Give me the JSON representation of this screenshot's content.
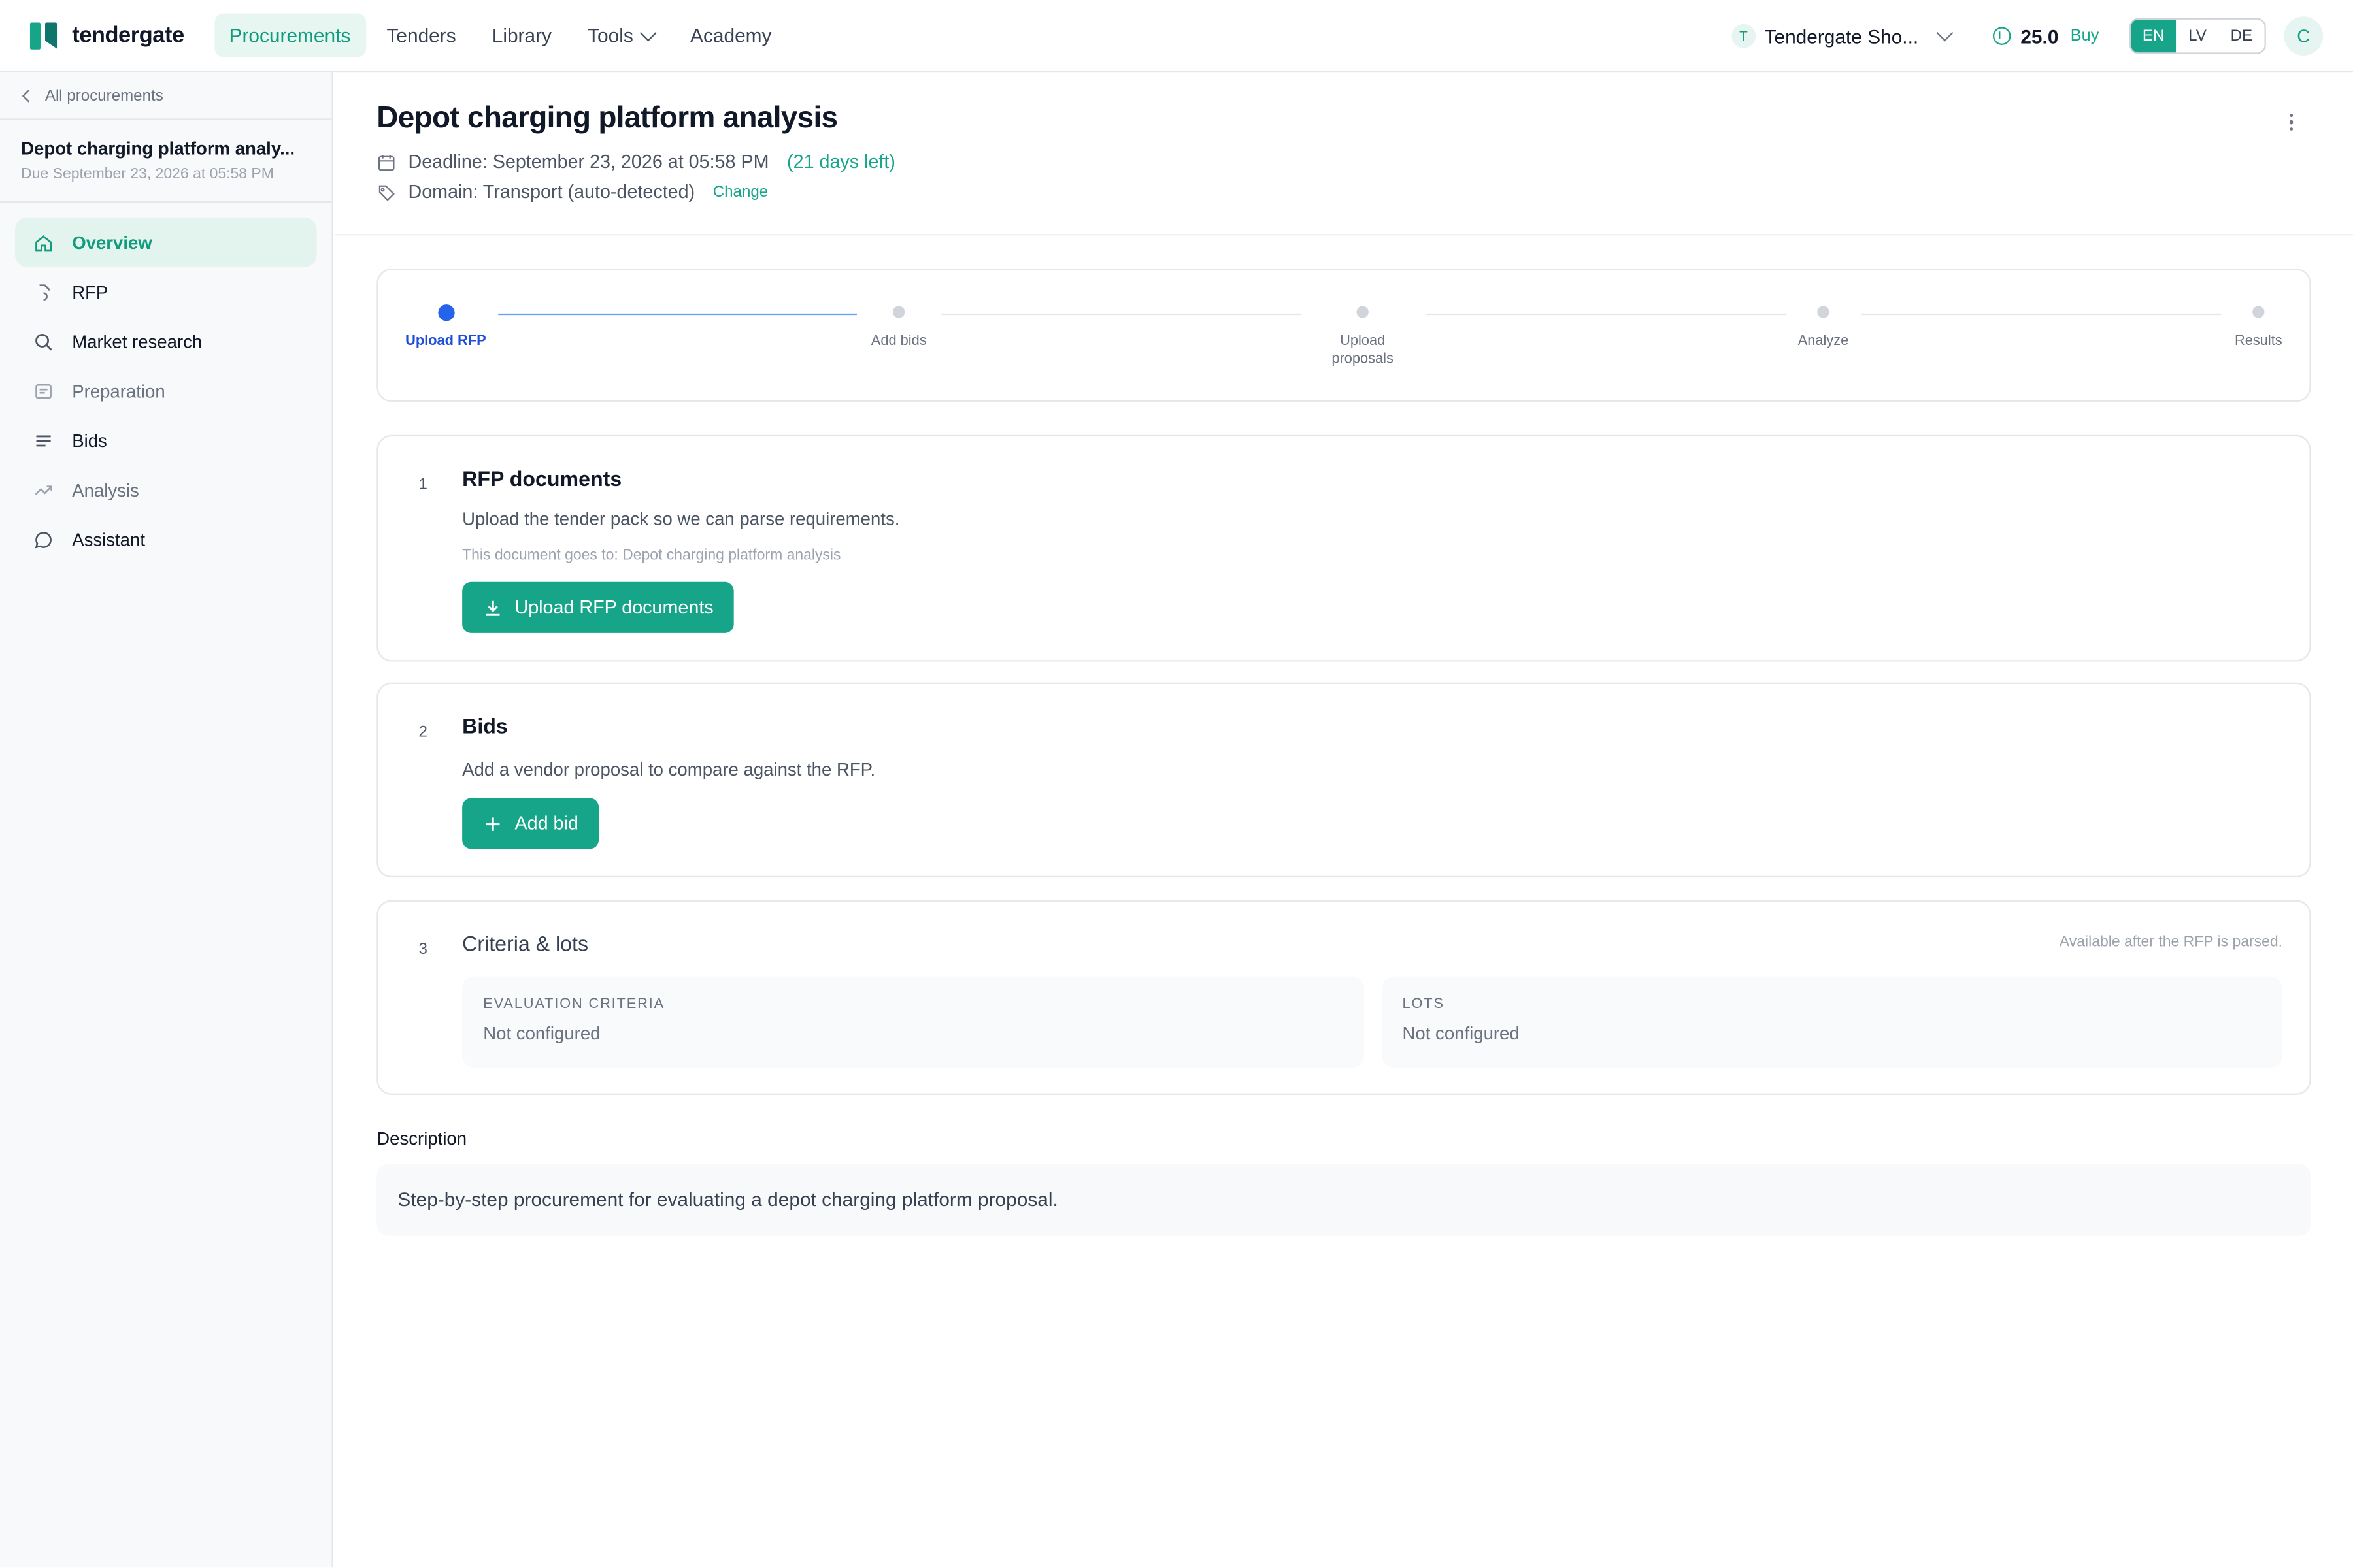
{
  "app": {
    "brand": "tendergate",
    "nav": [
      "Procurements",
      "Tenders",
      "Library",
      "Tools",
      "Academy"
    ],
    "org_initial": "T",
    "org_name": "Tendergate Sho...",
    "credits": "25.0",
    "buy_label": "Buy",
    "languages": [
      "EN",
      "LV",
      "DE"
    ],
    "user_initial": "C"
  },
  "sidebar": {
    "back_label": "All procurements",
    "title": "Depot charging platform analy...",
    "due": "Due September 23, 2026 at 05:58 PM",
    "items": [
      {
        "label": "Overview",
        "icon": "home-icon"
      },
      {
        "label": "RFP",
        "icon": "document-icon"
      },
      {
        "label": "Market research",
        "icon": "search-icon"
      },
      {
        "label": "Preparation",
        "icon": "clipboard-icon"
      },
      {
        "label": "Bids",
        "icon": "list-icon"
      },
      {
        "label": "Analysis",
        "icon": "trend-icon"
      },
      {
        "label": "Assistant",
        "icon": "chat-icon"
      }
    ]
  },
  "page": {
    "title": "Depot charging platform analysis",
    "deadline": "Deadline: September 23, 2026 at 05:58 PM",
    "days_left": "(21 days left)",
    "domain": "Domain: Transport (auto-detected)",
    "change_label": "Change"
  },
  "stepper": {
    "steps": [
      "Upload RFP",
      "Add bids",
      "Upload proposals",
      "Analyze",
      "Results"
    ],
    "active_index": 0
  },
  "cards": {
    "rfp": {
      "num": "1",
      "title": "RFP documents",
      "subtitle": "Upload the tender pack so we can parse requirements.",
      "hint": "This document goes to: Depot charging platform analysis",
      "button": "Upload RFP documents"
    },
    "bids": {
      "num": "2",
      "title": "Bids",
      "subtitle": "Add a vendor proposal to compare against the RFP.",
      "button": "Add bid"
    },
    "criteria": {
      "num": "3",
      "title": "Criteria & lots",
      "note": "Available after the RFP is parsed.",
      "criteria_label": "EVALUATION CRITERIA",
      "criteria_value": "Not configured",
      "lots_label": "LOTS",
      "lots_value": "Not configured"
    }
  },
  "description": {
    "label": "Description",
    "text": "Step-by-step procurement for evaluating a depot charging platform proposal."
  },
  "colors": {
    "accent": "#17a589",
    "active_step": "#2563eb"
  }
}
